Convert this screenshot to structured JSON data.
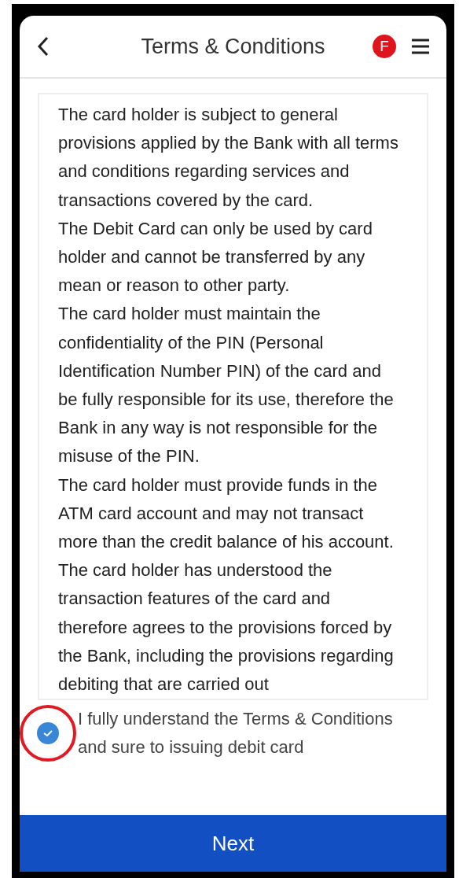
{
  "header": {
    "title": "Terms & Conditions",
    "badge": "F"
  },
  "terms": [
    "The card holder is subject to general provisions applied by the Bank with all terms and conditions regarding services and transactions covered by the card.",
    "The Debit Card can only be used by card holder and cannot be transferred by any mean or reason to other party.",
    "The card holder must maintain the confidentiality of the PIN (Personal Identification Number PIN) of the card and be fully responsible for its use, therefore the Bank in any way is not responsible for the misuse of the PIN.",
    "The card holder must provide funds in the ATM card account and may not transact more than the credit balance of his account.",
    "The card holder has understood the transaction features of the card and therefore agrees to the provisions forced by the Bank, including the provisions regarding debiting that are carried out"
  ],
  "agreement": {
    "label": "I fully understand the Terms & Conditions and sure to issuing debit card",
    "checked": true
  },
  "next_button": "Next"
}
